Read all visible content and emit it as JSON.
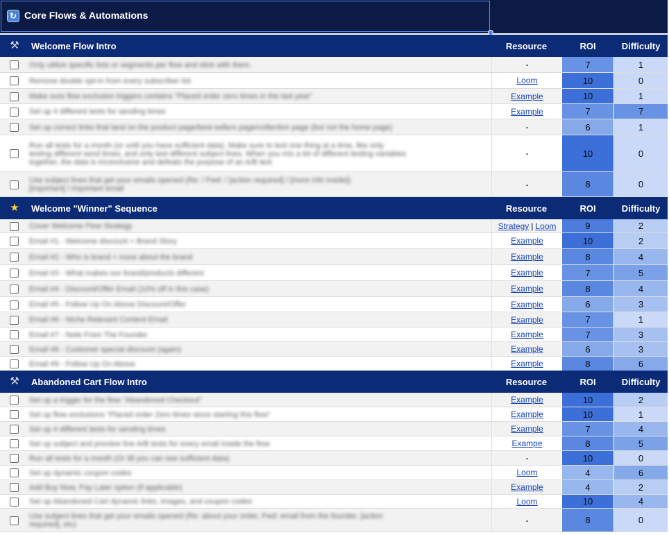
{
  "header": {
    "title": "Core Flows & Automations",
    "logo_icon": "sync-icon"
  },
  "columns": {
    "resource": "Resource",
    "roi": "ROI",
    "difficulty": "Difficulty"
  },
  "colors": {
    "heat_10": "#3d6fd8",
    "heat_9": "#4d7cdc",
    "heat_8": "#5a87e0",
    "heat_7": "#6893e4",
    "heat_6": "#86a9ea",
    "heat_5": "#7ba1e8",
    "heat_4": "#98b7ee",
    "heat_3": "#a6c1f1",
    "heat_2": "#b7cdf4",
    "heat_1": "#c9d9f7",
    "heat_0": "#c9d9f7"
  },
  "sections": [
    {
      "title": "Welcome Flow Intro",
      "icon": "tools-icon",
      "rows": [
        {
          "task": [
            "Only utilize specific lists or segments per flow and stick with them."
          ],
          "resource": [
            "-"
          ],
          "roi": 7,
          "difficulty": 1
        },
        {
          "task": [
            "Remove double opt-in from every subscriber list"
          ],
          "resource": [
            "Loom"
          ],
          "roi": 10,
          "difficulty": 0
        },
        {
          "task": [
            "Make sure flow exclusion triggers contains \"Placed order zero times in the last year\""
          ],
          "resource": [
            "Example"
          ],
          "roi": 10,
          "difficulty": 1
        },
        {
          "task": [
            "Set up 4 different tests for sending times"
          ],
          "resource": [
            "Example"
          ],
          "roi": 7,
          "difficulty": 7
        },
        {
          "task": [
            "Set up correct links that land on the product page/best-sellers page/collection page (but not the home page)"
          ],
          "resource": [
            "-"
          ],
          "roi": 6,
          "difficulty": 1
        },
        {
          "task": [
            "Run all tests for a month (or until you have sufficient data). Make sure to test one thing at a time, like only",
            "testing different send times, and only test different subject lines. When you mix a lot of different testing variables",
            "together, the data is inconclusive and defeats the purpose of an A/B test"
          ],
          "resource": [
            "-"
          ],
          "roi": 10,
          "difficulty": 0
        },
        {
          "task": [
            "Use subject lines that get your emails opened (Re: / Fwd: / [action required] / [more info inside])",
            "[important] / important email"
          ],
          "resource": [
            "-"
          ],
          "roi": 8,
          "difficulty": 0
        }
      ]
    },
    {
      "title": "Welcome \"Winner\" Sequence",
      "icon": "star-icon",
      "rows": [
        {
          "task": [
            "Cover Welcome Flow Strategy"
          ],
          "resource": [
            "Strategy",
            "Loom"
          ],
          "roi": 9,
          "difficulty": 2
        },
        {
          "task": [
            "Email #1 - Welcome discount + Brand Story"
          ],
          "resource": [
            "Example"
          ],
          "roi": 10,
          "difficulty": 2
        },
        {
          "task": [
            "Email #2 - Who is brand + more about the brand"
          ],
          "resource": [
            "Example"
          ],
          "roi": 8,
          "difficulty": 4
        },
        {
          "task": [
            "Email #3 - What makes our brand/products different"
          ],
          "resource": [
            "Example"
          ],
          "roi": 7,
          "difficulty": 5
        },
        {
          "task": [
            "Email #4 - Discount/Offer Email (10% off in this case)"
          ],
          "resource": [
            "Example"
          ],
          "roi": 8,
          "difficulty": 4
        },
        {
          "task": [
            "Email #5 - Follow Up On Above Discount/Offer"
          ],
          "resource": [
            "Example"
          ],
          "roi": 6,
          "difficulty": 3
        },
        {
          "task": [
            "Email #6 - Niche Relevant Content Email"
          ],
          "resource": [
            "Example"
          ],
          "roi": 7,
          "difficulty": 1
        },
        {
          "task": [
            "Email #7 - Note From The Founder"
          ],
          "resource": [
            "Example"
          ],
          "roi": 7,
          "difficulty": 3
        },
        {
          "task": [
            "Email #8 - Customer special discount (again)"
          ],
          "resource": [
            "Example"
          ],
          "roi": 6,
          "difficulty": 3
        },
        {
          "task": [
            "Email #9 - Follow Up On Above"
          ],
          "resource": [
            "Example"
          ],
          "roi": 8,
          "difficulty": 6
        }
      ]
    },
    {
      "title": "Abandoned Cart Flow Intro",
      "icon": "tools-icon",
      "rows": [
        {
          "task": [
            "Set up a trigger for the flow \"Abandoned Checkout\""
          ],
          "resource": [
            "Example"
          ],
          "roi": 10,
          "difficulty": 2
        },
        {
          "task": [
            "Set up flow exclusions \"Placed order Zero times since starting this flow\""
          ],
          "resource": [
            "Example"
          ],
          "roi": 10,
          "difficulty": 1
        },
        {
          "task": [
            "Set up 4 different tests for sending times"
          ],
          "resource": [
            "Example"
          ],
          "roi": 7,
          "difficulty": 4
        },
        {
          "task": [
            "Set up subject and preview line A/B tests for every email inside the flow"
          ],
          "resource": [
            "Exampe"
          ],
          "roi": 8,
          "difficulty": 5
        },
        {
          "task": [
            "Run all tests for a month (Or till you can see sufficient data)"
          ],
          "resource": [
            "-"
          ],
          "roi": 10,
          "difficulty": 0
        },
        {
          "task": [
            "Set up dynamic coupon codes"
          ],
          "resource": [
            "Loom"
          ],
          "roi": 4,
          "difficulty": 6
        },
        {
          "task": [
            "Add Buy Now, Pay Later option (if applicable)"
          ],
          "resource": [
            "Example"
          ],
          "roi": 4,
          "difficulty": 2
        },
        {
          "task": [
            "Set up Abandoned Cart dynamic links, images, and coupon codes"
          ],
          "resource": [
            "Loom"
          ],
          "roi": 10,
          "difficulty": 4
        },
        {
          "task": [
            "Use subject lines that get your emails opened (Re: about your order, Fwd: email from the founder, [action",
            "required], etc)"
          ],
          "resource": [
            "-"
          ],
          "roi": 8,
          "difficulty": 0
        }
      ]
    }
  ]
}
